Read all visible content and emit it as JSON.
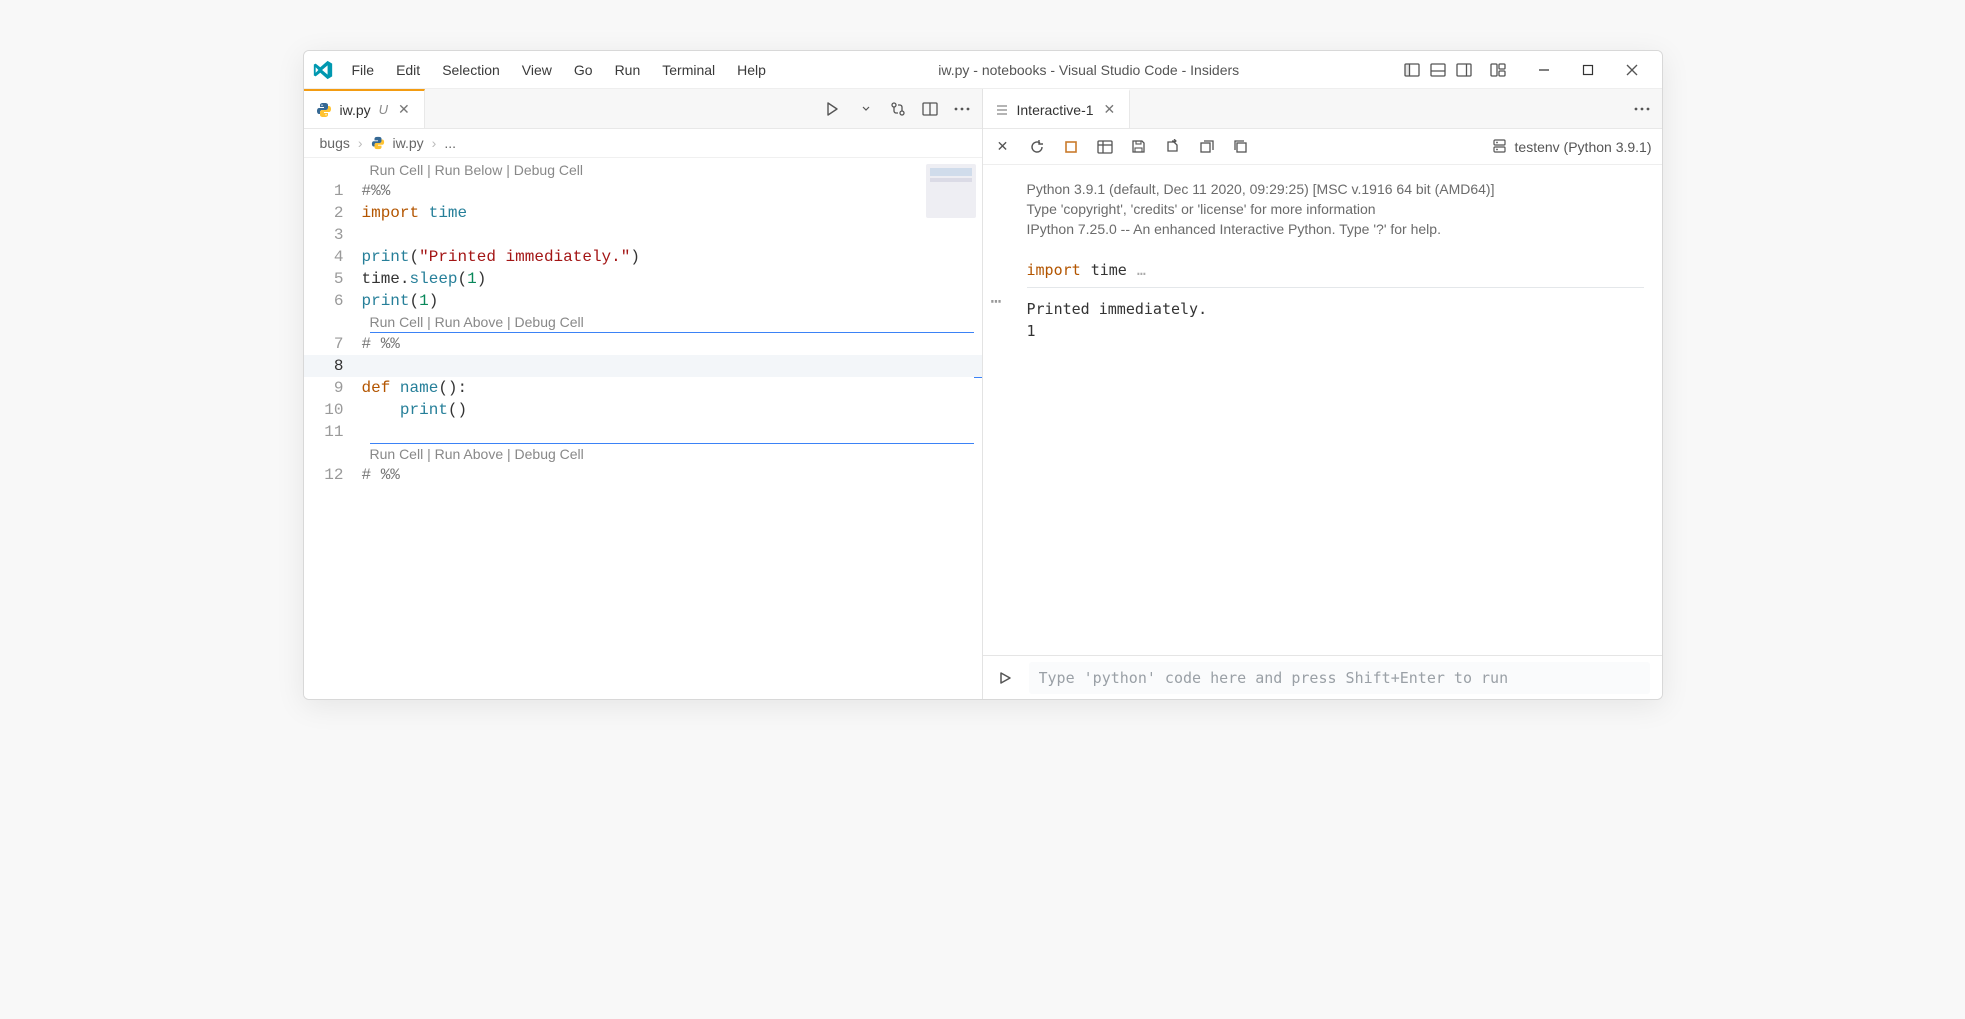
{
  "window": {
    "title": "iw.py - notebooks - Visual Studio Code - Insiders",
    "menu": [
      "File",
      "Edit",
      "Selection",
      "View",
      "Go",
      "Run",
      "Terminal",
      "Help"
    ]
  },
  "left": {
    "tab": {
      "label": "iw.py",
      "dirty_marker": "U"
    },
    "breadcrumb": {
      "folder": "bugs",
      "file": "iw.py",
      "trail": "..."
    },
    "codelens_top": "Run Cell | Run Below | Debug Cell",
    "codelens_mid": "Run Cell | Run Above | Debug Cell",
    "codelens_bot": "Run Cell | Run Above | Debug Cell",
    "lines": {
      "l1": "#%%",
      "l2": {
        "kw": "import",
        "mod": " time"
      },
      "l3": "",
      "l4": {
        "fn": "print",
        "open": "(",
        "str": "\"Printed immediately.\"",
        "close": ")"
      },
      "l5": {
        "mod": "time",
        "dot": ".",
        "call": "sleep",
        "open": "(",
        "num": "1",
        "close": ")"
      },
      "l6": {
        "fn": "print",
        "open": "(",
        "num": "1",
        "close": ")"
      },
      "l7": "# %%",
      "l8": "",
      "l9": {
        "kw": "def",
        "name": " name",
        "sig": "():"
      },
      "l10": {
        "indent": "    ",
        "fn": "print",
        "open": "(",
        "close": ")"
      },
      "l11": "",
      "l12": "# %%"
    }
  },
  "right": {
    "tab": {
      "label": "Interactive-1"
    },
    "kernel": "testenv (Python 3.9.1)",
    "banner": {
      "l1": "Python 3.9.1 (default, Dec 11 2020, 09:29:25) [MSC v.1916 64 bit (AMD64)]",
      "l2": "Type 'copyright', 'credits' or 'license' for more information",
      "l3": "IPython 7.25.0 -- An enhanced Interactive Python. Type '?' for help."
    },
    "cell_head": {
      "kw": "import",
      "mod": " time",
      "ell": " …"
    },
    "output": "Printed immediately.\n1",
    "input_placeholder": "Type 'python' code here and press Shift+Enter to run"
  }
}
